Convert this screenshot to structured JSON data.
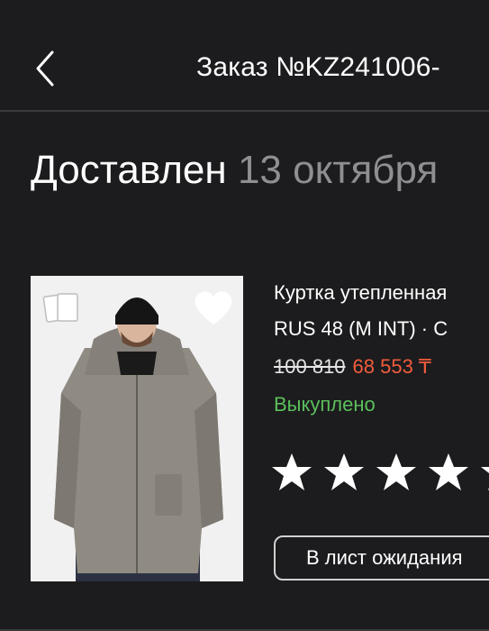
{
  "header": {
    "order_title": "Заказ №KZ241006-"
  },
  "order": {
    "status": "Доставлен",
    "status_date": "13 октября"
  },
  "product": {
    "name": "Куртка утепленная",
    "size": "RUS 48 (M INT) · C",
    "old_price": "100 810",
    "new_price": "68 553 ₸",
    "status": "Выкуплено",
    "status_color": "#5bbf5b",
    "price_color": "#f25c3c"
  },
  "rating": {
    "star_count_visible": 5,
    "icon": "star-icon"
  },
  "actions": {
    "waitlist_label": "В лист ожидания"
  },
  "icons": {
    "back": "chevron-left-icon",
    "cards": "cards-icon",
    "favorite": "heart-icon"
  }
}
